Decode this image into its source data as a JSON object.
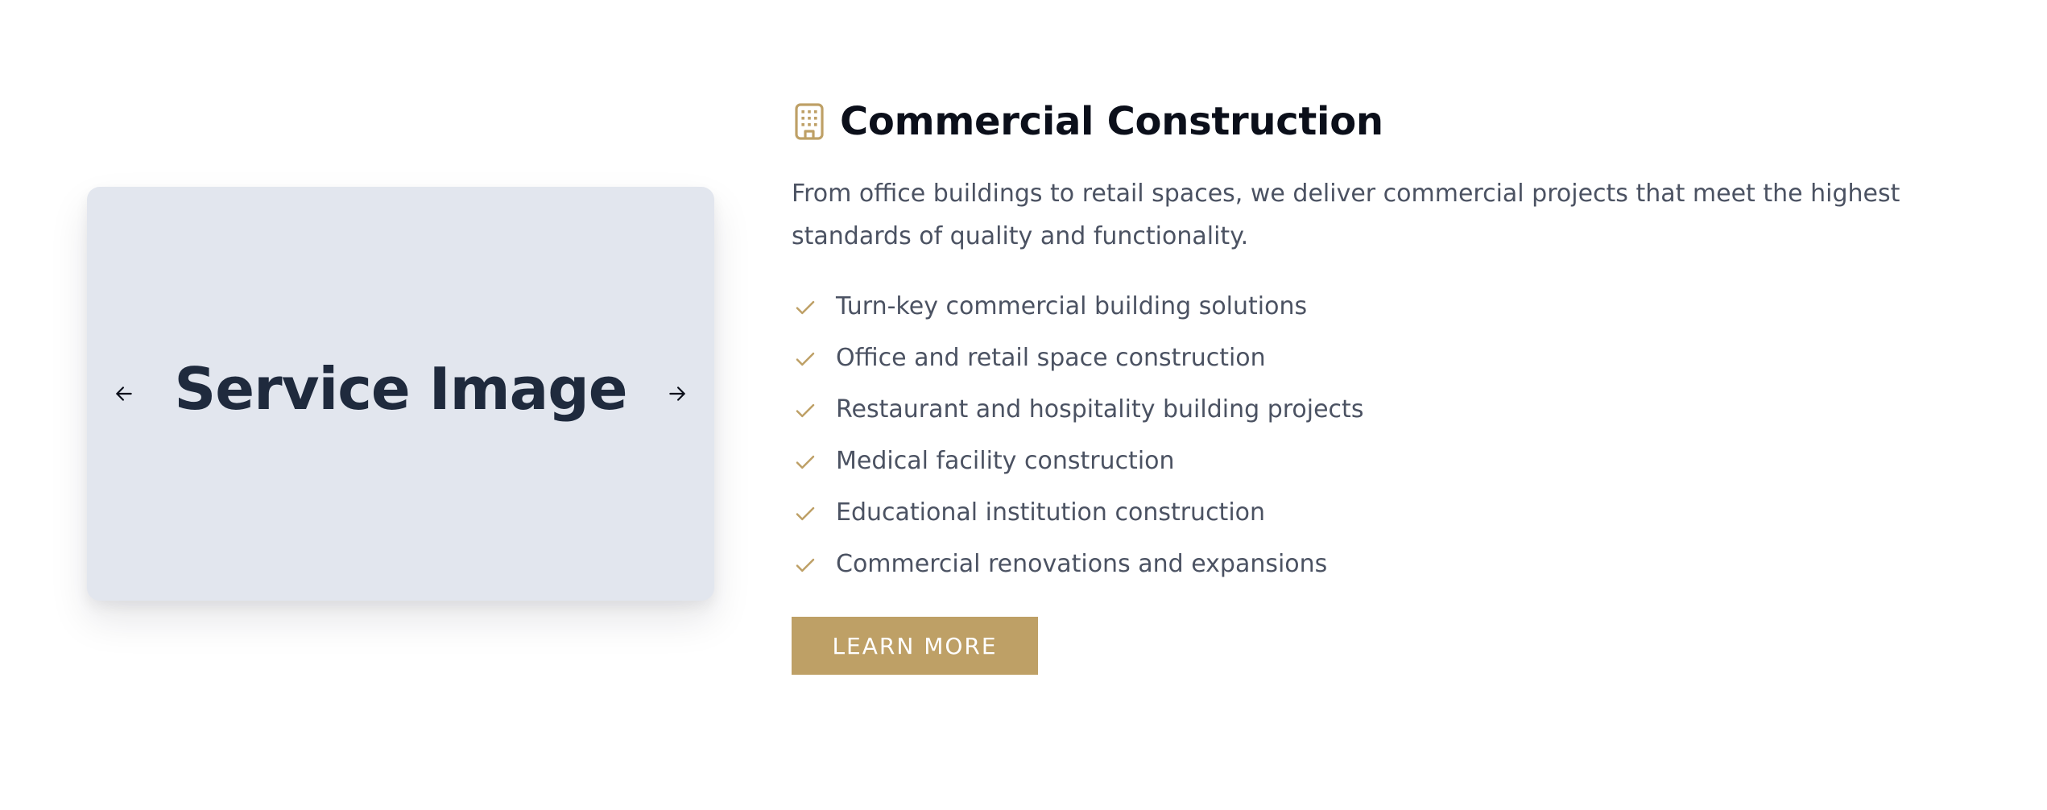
{
  "colors": {
    "accent": "#bea066",
    "placeholder_bg": "#e2e6ee",
    "heading": "#0b0f1a",
    "body_text": "#4b5262",
    "placeholder_text": "#1f2a3d"
  },
  "carousel": {
    "label": "Service Image",
    "prev_icon": "arrow-left-icon",
    "next_icon": "arrow-right-icon"
  },
  "service": {
    "icon": "building-icon",
    "title": "Commercial Construction",
    "description": "From office buildings to retail spaces, we deliver commercial projects that meet the highest standards of quality and functionality.",
    "features": [
      "Turn-key commercial building solutions",
      "Office and retail space construction",
      "Restaurant and hospitality building projects",
      "Medical facility construction",
      "Educational institution construction",
      "Commercial renovations and expansions"
    ],
    "feature_icon": "check-icon",
    "cta_label": "LEARN MORE"
  }
}
